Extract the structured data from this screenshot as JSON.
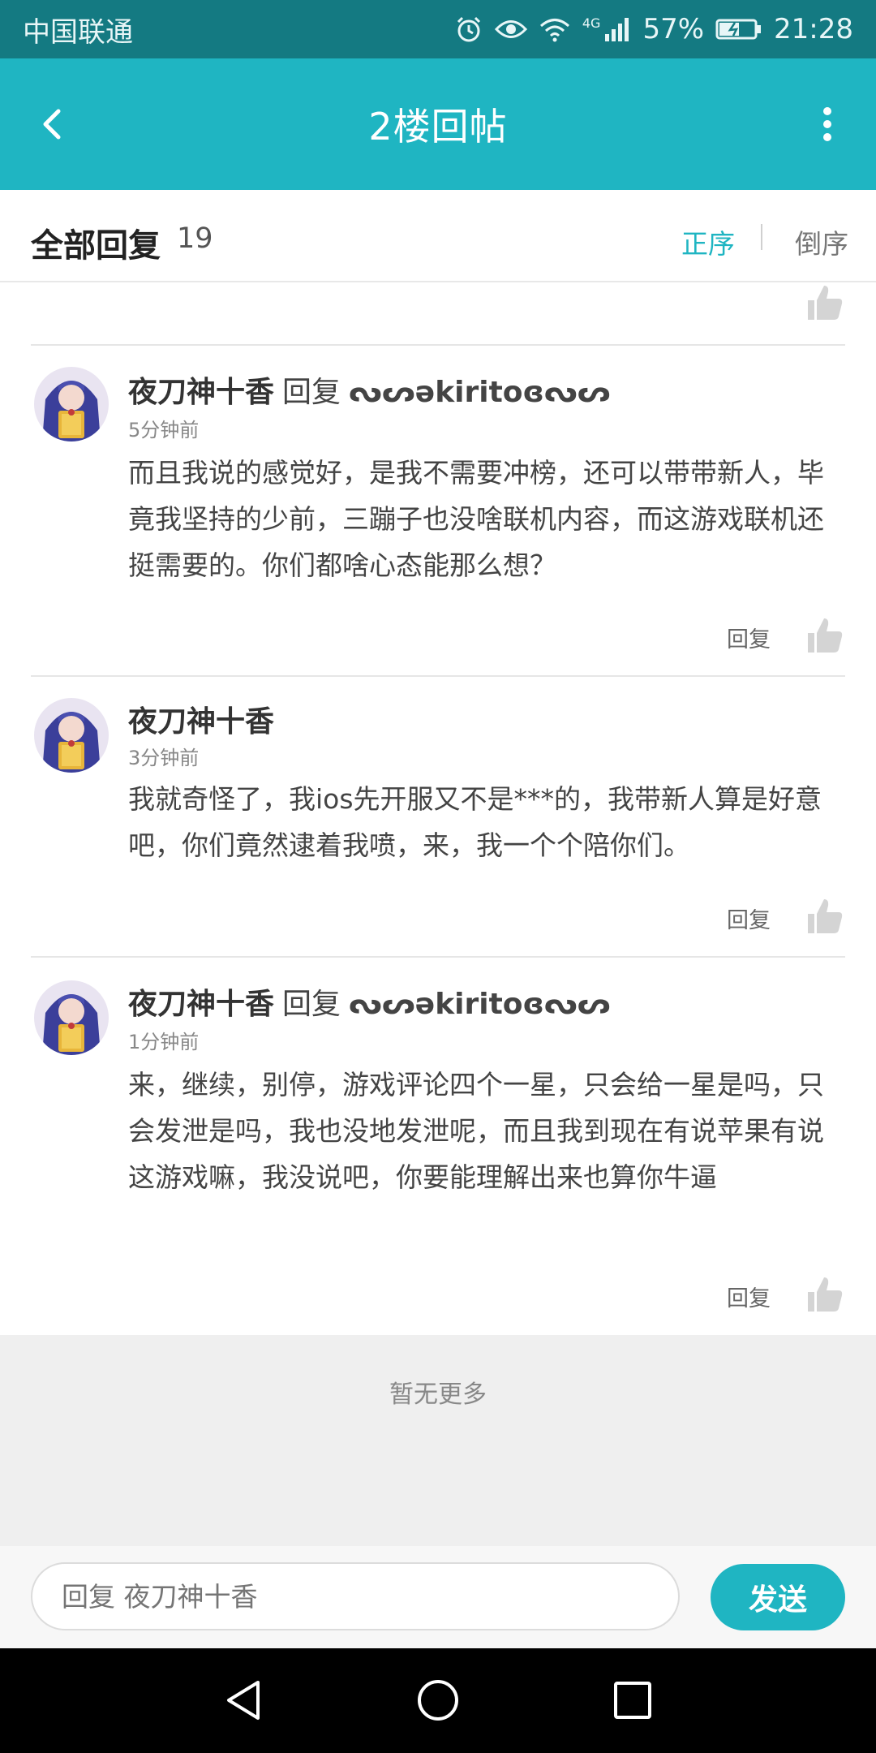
{
  "status_bar": {
    "carrier": "中国联通",
    "network": "4G",
    "battery": "57%",
    "time": "21:28",
    "icons": [
      "alarm-icon",
      "eye-icon",
      "wifi-icon",
      "signal-icon",
      "battery-icon"
    ]
  },
  "app_bar": {
    "title": "2楼回帖",
    "back_icon": "back-arrow-icon",
    "menu_icon": "more-vertical-icon"
  },
  "replies_header": {
    "label": "全部回复",
    "count": "19",
    "sort_asc": "正序",
    "sort_desc": "倒序"
  },
  "comments": [
    {
      "author": "夜刀神十香",
      "reply_word": "回复",
      "target": "ᔓᔕəkiritoɞᔓᔕ",
      "time": "5分钟前",
      "text": "而且我说的感觉好，是我不需要冲榜，还可以带带新人，毕竟我坚持的少前，三蹦子也没啥联机内容，而这游戏联机还挺需要的。你们都啥心态能那么想？",
      "reply_label": "回复"
    },
    {
      "author": "夜刀神十香",
      "time": "3分钟前",
      "text": "我就奇怪了，我ios先开服又不是***的，我带新人算是好意吧，你们竟然逮着我喷，来，我一个个陪你们。",
      "reply_label": "回复"
    },
    {
      "author": "夜刀神十香",
      "reply_word": "回复",
      "target": "ᔓᔕəkiritoɞᔓᔕ",
      "time": "1分钟前",
      "text": "来，继续，别停，游戏评论四个一星，只会给一星是吗，只会发泄是吗，我也没地发泄呢，而且我到现在有说苹果有说这游戏嘛，我没说吧，你要能理解出来也算你牛逼",
      "reply_label": "回复"
    }
  ],
  "footer": {
    "no_more": "暂无更多"
  },
  "input_bar": {
    "placeholder": "回复 夜刀神十香",
    "send_label": "发送"
  },
  "colors": {
    "status_bar": "#147a82",
    "accent": "#1fb5c2",
    "thumb": "#d4d4d4"
  },
  "nav_bar": {
    "icons": [
      "nav-back-icon",
      "nav-home-icon",
      "nav-recents-icon"
    ]
  }
}
